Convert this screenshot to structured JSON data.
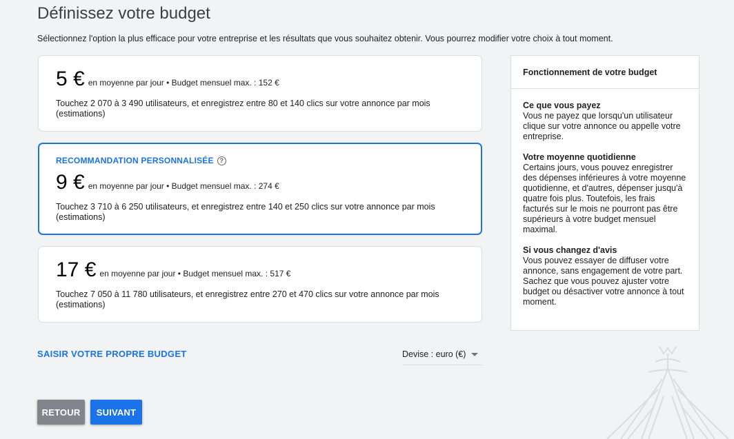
{
  "header": {
    "title": "Définissez votre budget",
    "subtitle": "Sélectionnez l'option la plus efficace pour votre entreprise et les résultats que vous souhaitez obtenir. Vous pourrez modifier votre choix à tout moment."
  },
  "options": [
    {
      "price": "5 €",
      "description": "en moyenne par jour • Budget mensuel max. : 152 €",
      "reach": "Touchez 2 070 à 3 490 utilisateurs, et enregistrez entre 80 et 140 clics sur votre annonce par mois (estimations)"
    },
    {
      "badge": "RECOMMANDATION PERSONNALISÉE",
      "badge_icon": "help-circle-icon",
      "price": "9 €",
      "description": "en moyenne par jour • Budget mensuel max. : 274 €",
      "reach": "Touchez 3 710 à 6 250 utilisateurs, et enregistrez entre 140 et 250 clics sur votre annonce par mois (estimations)",
      "selected": true
    },
    {
      "price": "17 €",
      "description": "en moyenne par jour • Budget mensuel max. : 517 €",
      "reach": "Touchez 7 050 à 11 780 utilisateurs, et enregistrez entre 270 et 470 clics sur votre annonce par mois (estimations)"
    }
  ],
  "info_panel": {
    "title": "Fonctionnement de votre budget",
    "sections": [
      {
        "heading": "Ce que vous payez",
        "text": "Vous ne payez que lorsqu'un utilisateur clique sur votre annonce ou appelle votre entreprise."
      },
      {
        "heading": "Votre moyenne quotidienne",
        "text": "Certains jours, vous pouvez enregistrer des dépenses inférieures à votre moyenne quotidienne, et d'autres, dépenser jusqu'à quatre fois plus. Toutefois, les frais facturés sur le mois ne pourront pas être supérieurs à votre budget mensuel maximal."
      },
      {
        "heading": "Si vous changez d'avis",
        "text": "Vous pouvez essayer de diffuser votre annonce, sans engagement de votre part. Sachez que vous pouvez ajuster votre budget ou désactiver votre annonce à tout moment."
      }
    ]
  },
  "own_budget_link": "SAISIR VOTRE PROPRE BUDGET",
  "currency": {
    "value": "Devise : euro (€)",
    "icon": "dropdown-arrow-icon"
  },
  "buttons": {
    "back": "RETOUR",
    "next": "SUIVANT"
  },
  "colors": {
    "accent": "#1a73e8",
    "background": "#f1f3f4",
    "back_button": "#80868b"
  }
}
